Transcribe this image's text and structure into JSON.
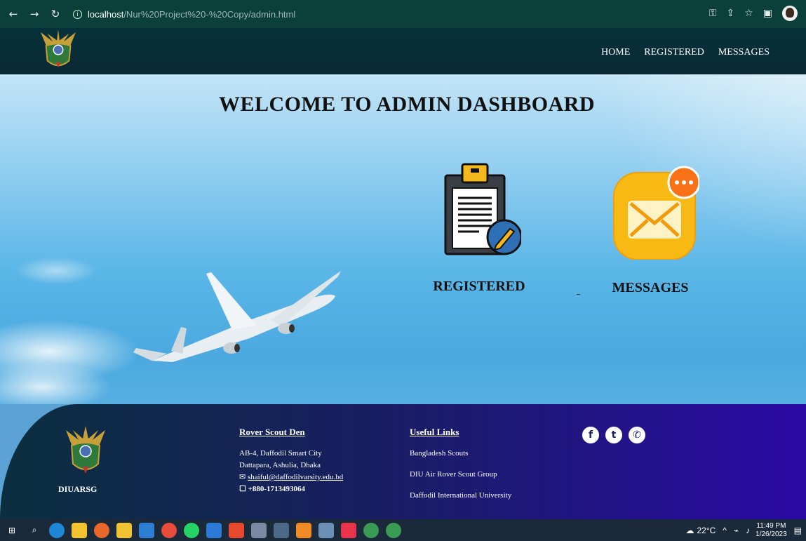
{
  "browser": {
    "url_host": "localhost",
    "url_path": "/Nur%20Project%20-%20Copy/admin.html"
  },
  "nav": {
    "home": "HOME",
    "registered": "REGISTERED",
    "messages": "MESSAGES"
  },
  "hero": {
    "title": "WELCOME TO ADMIN DASHBOARD",
    "registered_label": "REGISTERED",
    "messages_label": "MESSAGES"
  },
  "footer": {
    "brand": "DIUARSG",
    "rover": {
      "heading": "Rover Scout Den",
      "address1": "AB-4, Daffodil Smart City",
      "address2": "Dattapara, Ashulia, Dhaka",
      "email": "shaiful@daffodilvarsity.edu.bd",
      "phone": "+880-1713493064"
    },
    "links": {
      "heading": "Useful Links",
      "items": [
        "Bangladesh Scouts",
        "DIU Air Rover Scout Group",
        "Daffodil International University"
      ]
    },
    "social": [
      "facebook-icon",
      "twitter-icon",
      "whatsapp-icon"
    ]
  },
  "taskbar": {
    "weather": "22°C",
    "time": "11:49 PM",
    "date": "1/26/2023"
  },
  "colors": {
    "header": "#0b2935",
    "footer_start": "#0b2f3f",
    "footer_end": "#2a0aa5",
    "sky": "#5ab6e7"
  }
}
